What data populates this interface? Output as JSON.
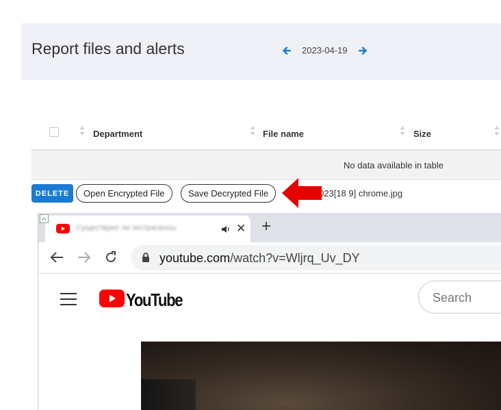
{
  "page": {
    "title": "Report files and alerts"
  },
  "date_nav": {
    "date": "2023-04-19",
    "prev_icon": "arrow-left-icon",
    "next_icon": "arrow-right-icon"
  },
  "table": {
    "columns": [
      "Department",
      "File name",
      "Size"
    ],
    "empty_text": "No data available in table"
  },
  "row_actions": {
    "delete_label": "DELETE",
    "open_label": "Open Encrypted File",
    "save_label": "Save Decrypted File",
    "filename": "023[18 9] chrome.jpg"
  },
  "colors": {
    "accent": "#1c7bd0",
    "arrow": "#e80000",
    "panel": "#eff1f6"
  },
  "embedded_browser": {
    "tab_title": "Существуют ли экстрасенсы",
    "new_tab_label": "+",
    "url_domain": "youtube.com",
    "url_path": "/watch?v=Wljrq_Uv_DY",
    "logo_text": "YouTube",
    "search_placeholder": "Search"
  }
}
